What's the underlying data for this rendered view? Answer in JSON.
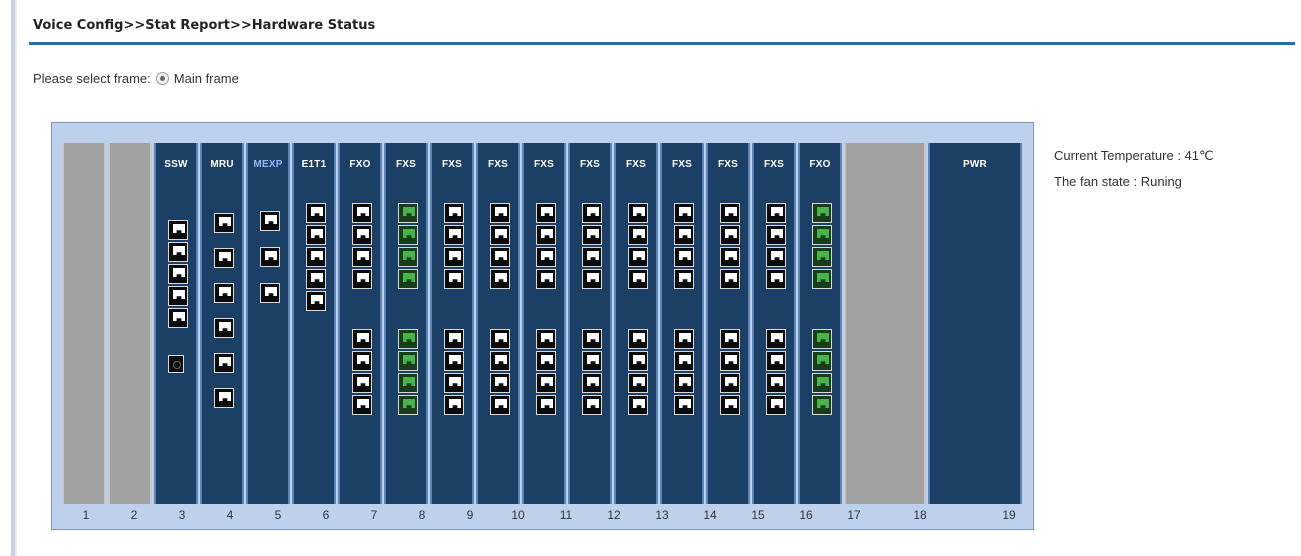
{
  "breadcrumb": "Voice Config>>Stat Report>>Hardware Status",
  "frame_select": {
    "label": "Please select frame:",
    "option": "Main frame",
    "selected": true
  },
  "chassis": {
    "slots": [
      {
        "number": "1",
        "label": "",
        "type": "empty"
      },
      {
        "number": "2",
        "label": "",
        "type": "empty"
      },
      {
        "number": "3",
        "label": "SSW",
        "type": "card"
      },
      {
        "number": "4",
        "label": "MRU",
        "type": "card"
      },
      {
        "number": "5",
        "label": "MEXP",
        "type": "card"
      },
      {
        "number": "6",
        "label": "E1T1",
        "type": "card"
      },
      {
        "number": "7",
        "label": "FXO",
        "type": "card"
      },
      {
        "number": "8",
        "label": "FXS",
        "type": "card"
      },
      {
        "number": "9",
        "label": "FXS",
        "type": "card"
      },
      {
        "number": "10",
        "label": "FXS",
        "type": "card"
      },
      {
        "number": "11",
        "label": "FXS",
        "type": "card"
      },
      {
        "number": "12",
        "label": "FXS",
        "type": "card"
      },
      {
        "number": "13",
        "label": "FXS",
        "type": "card"
      },
      {
        "number": "14",
        "label": "FXS",
        "type": "card"
      },
      {
        "number": "15",
        "label": "FXS",
        "type": "card"
      },
      {
        "number": "16",
        "label": "FXS",
        "type": "card"
      },
      {
        "number": "17",
        "label": "FXO",
        "type": "card"
      },
      {
        "number": "18",
        "label": "",
        "type": "empty"
      },
      {
        "number": "19",
        "label": "PWR",
        "type": "power"
      }
    ]
  },
  "status": {
    "temperature": "Current Temperature : 41℃",
    "fan": "The fan state : Runing"
  },
  "colors": {
    "accent": "#2a6ea7",
    "card": "#1c3f66",
    "chassis": "#bed1ec",
    "empty_slot": "#a1a1a1",
    "active_port": "#46b44a"
  }
}
